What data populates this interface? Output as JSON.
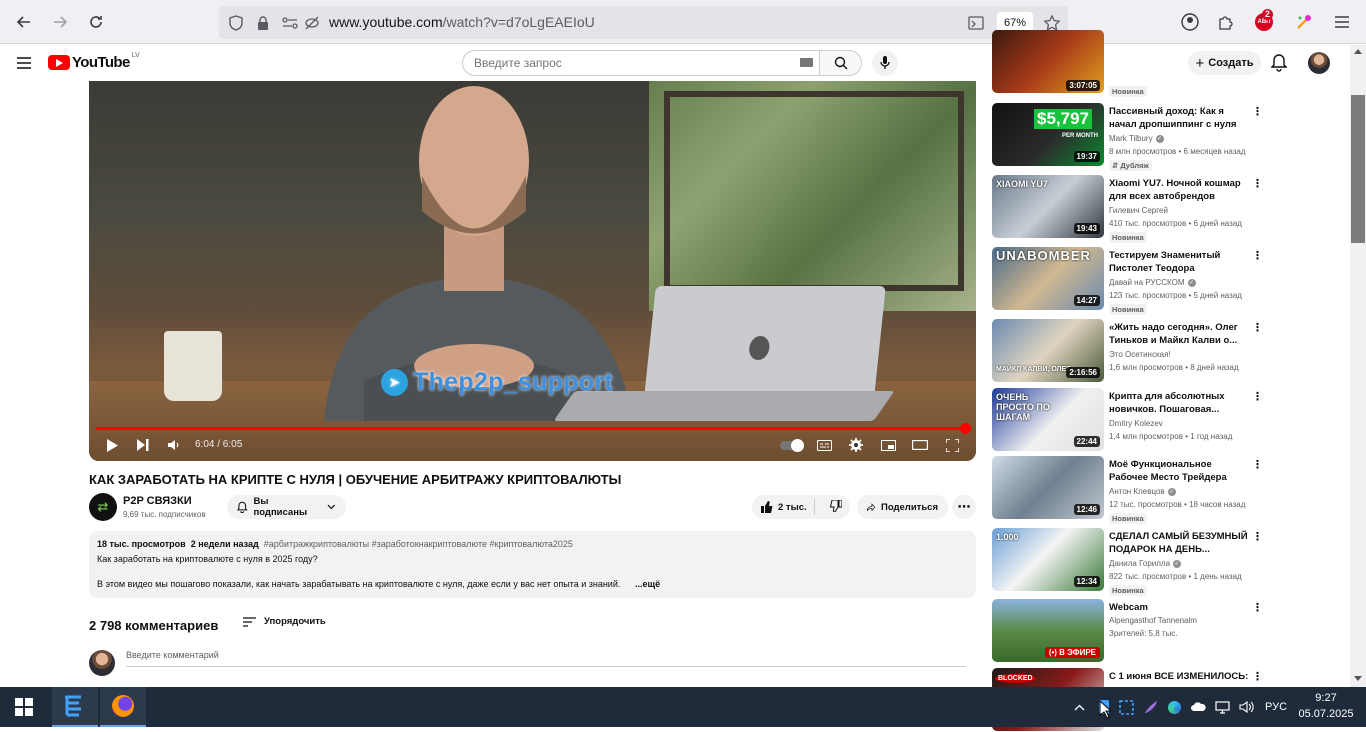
{
  "browser": {
    "url_prefix": "www.youtube.com",
    "url_path": "/watch?v=d7oLgEAEIoU",
    "zoom": "67%",
    "extension_badge": "2",
    "extension_badge_label": "АВП"
  },
  "header": {
    "logo_text": "YouTube",
    "logo_region": "LV",
    "search_placeholder": "Введите запрос",
    "create_label": "Создать"
  },
  "player": {
    "overlay_text": "Thep2p_support",
    "current_time": "6:04",
    "duration": "6:05",
    "time_display": "6:04 / 6:05",
    "progress_fraction": 0.997
  },
  "video": {
    "title": "КАК ЗАРАБОТАТЬ НА КРИПТЕ С НУЛЯ | ОБУЧЕНИЕ АРБИТРАЖУ КРИПТОВАЛЮТЫ",
    "channel": "P2P СВЯЗКИ",
    "subscribers": "9,69 тыс. подписчиков",
    "subscribed_label": "Вы подписаны",
    "likes": "2 тыс.",
    "share_label": "Поделиться"
  },
  "description": {
    "views": "18 тыс. просмотров",
    "date": "2 недели назад",
    "tags": "#арбитражкриптовалюты #заработокнакриптовалюте #криптовалюта2025",
    "line1": "Как заработать на криптовалюте с нуля в 2025 году?",
    "line2": "В этом видео мы пошагово показали, как начать зарабатывать на криптовалюте с нуля, даже если у вас нет опыта и знаний.",
    "more": "...ещё"
  },
  "comments": {
    "count": "2 798 комментариев",
    "sort_label": "Упорядочить",
    "input_placeholder": "Введите комментарий"
  },
  "sidebar": {
    "items": [
      {
        "title": "",
        "channel": "",
        "views": "",
        "duration": "3:07:05",
        "badge": "Новинка",
        "live": ""
      },
      {
        "title": "Пассивный доход: Как я начал дропшиппинг с нуля",
        "channel": "Mark Tilbury",
        "verified": true,
        "views": "8 млн просмотров • 6 месяцев назад",
        "duration": "19:37",
        "badge": "Дубляж",
        "thumb_text": "$5,797",
        "thumb_sub": "PER MONTH",
        "live": ""
      },
      {
        "title": "Xiaomi YU7. Ночной кошмар для всех автобрендов",
        "channel": "Гилевич Сергей",
        "verified": false,
        "views": "410 тыс. просмотров • 6 дней назад",
        "duration": "19:43",
        "badge": "Новинка",
        "thumb_text": "XIAOMI YU7",
        "live": ""
      },
      {
        "title": "Тестируем Знаменитый Пистолет Теодора Качинского...",
        "channel": "Давай на РУССКОМ",
        "verified": true,
        "views": "123 тыс. просмотров • 5 дней назад",
        "duration": "14:27",
        "badge": "Новинка",
        "thumb_text": "UNABOMBER",
        "live": ""
      },
      {
        "title": "«Жить надо сегодня». Олег Тиньков и Майкл Калви о...",
        "channel": "Это Осетинская!",
        "verified": false,
        "views": "1,6 млн просмотров • 8 дней назад",
        "duration": "2:16:56",
        "badge": "",
        "thumb_text": "МАЙКЛ КАЛВИ, ОЛЕГ",
        "live": ""
      },
      {
        "title": "Крипта для абсолютных новичков. Пошаговая...",
        "channel": "Dmitry Kolezev",
        "verified": false,
        "views": "1,4 млн просмотров • 1 год назад",
        "duration": "22:44",
        "badge": "",
        "thumb_text": "ОЧЕНЬ ПРОСТО ПО ШАГАМ",
        "live": ""
      },
      {
        "title": "Моё Функциональное Рабочее Место Трейдера",
        "channel": "Антон Клевцов",
        "verified": true,
        "views": "12 тыс. просмотров • 18 часов назад",
        "duration": "12:46",
        "badge": "Новинка",
        "live": ""
      },
      {
        "title": "СДЕЛАЛ САМЫЙ БЕЗУМНЫЙ ПОДАРОК НА ДЕНЬ...",
        "channel": "Данила Горилла",
        "verified": true,
        "views": "822 тыс. просмотров • 1 день назад",
        "duration": "12:34",
        "badge": "Новинка",
        "thumb_text": "1.000",
        "live": ""
      },
      {
        "title": "Webcam",
        "channel": "Alpengasthof Tannenalm",
        "verified": false,
        "views": "Зрителей: 5,8 тыс.",
        "duration": "",
        "badge": "",
        "live": "В ЭФИРЕ"
      },
      {
        "title": "С 1 июня ВСЕ ИЗМЕНИЛОСЬ:",
        "channel": "",
        "verified": false,
        "views": "",
        "duration": "",
        "badge": "",
        "thumb_text": "BLOCKED",
        "live": ""
      }
    ]
  },
  "taskbar": {
    "language": "РУС",
    "time": "9:27",
    "date": "05.07.2025"
  },
  "colors": {
    "yt_red": "#ff0000",
    "taskbar_bg": "#1f2a3a",
    "chip_bg": "#f2f2f2"
  }
}
